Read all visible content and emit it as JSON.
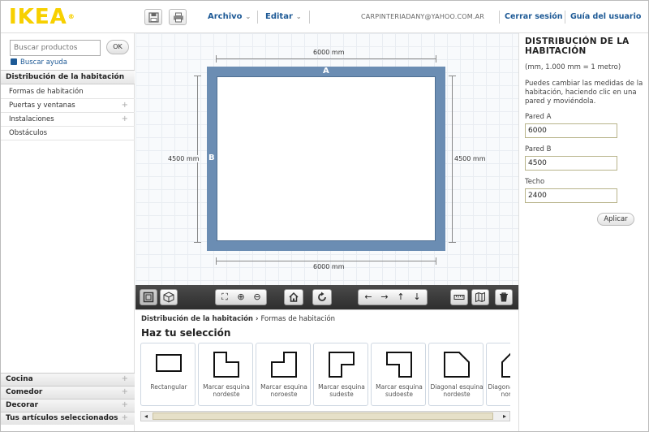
{
  "header": {
    "logo": "IKEA",
    "logo_mark": "®",
    "menu_file": "Archivo",
    "menu_edit": "Editar",
    "user_email": "CARPINTERIADANY@YAHOO.COM.AR",
    "logout": "Cerrar sesión",
    "guide": "Guía del usuario"
  },
  "left": {
    "search_placeholder": "Buscar productos",
    "ok": "OK",
    "help": "Buscar ayuda",
    "section": "Distribución de la habitación",
    "items": [
      "Formas de habitación",
      "Puertas y ventanas",
      "Instalaciones",
      "Obstáculos"
    ],
    "bottom": [
      "Cocina",
      "Comedor",
      "Decorar",
      "Tus artículos seleccionados"
    ]
  },
  "canvas": {
    "top_dim": "6000 mm",
    "bottom_dim": "6000 mm",
    "left_dim": "4500 mm",
    "right_dim": "4500 mm",
    "wall_a": "A",
    "wall_b": "B",
    "wall_color": "#6b8db3"
  },
  "selection": {
    "crumb_parent": "Distribución de la habitación",
    "crumb_sep": "›",
    "crumb_current": "Formas de habitación",
    "title": "Haz tu selección",
    "tiles": [
      "Rectangular",
      "Marcar esquina nordeste",
      "Marcar esquina noroeste",
      "Marcar esquina sudeste",
      "Marcar esquina sudoeste",
      "Diagonal esquina nordeste",
      "Diagonal esquina noroeste"
    ]
  },
  "right": {
    "title": "DISTRIBUCIÓN DE LA HABITACIÓN",
    "subtitle": "(mm, 1.000 mm = 1 metro)",
    "description": "Puedes cambiar las medidas de la habitación, haciendo clic en una pared y moviéndola.",
    "wall_a_label": "Pared A",
    "wall_a_value": "6000",
    "wall_b_label": "Pared B",
    "wall_b_value": "4500",
    "ceiling_label": "Techo",
    "ceiling_value": "2400",
    "apply": "Aplicar"
  }
}
